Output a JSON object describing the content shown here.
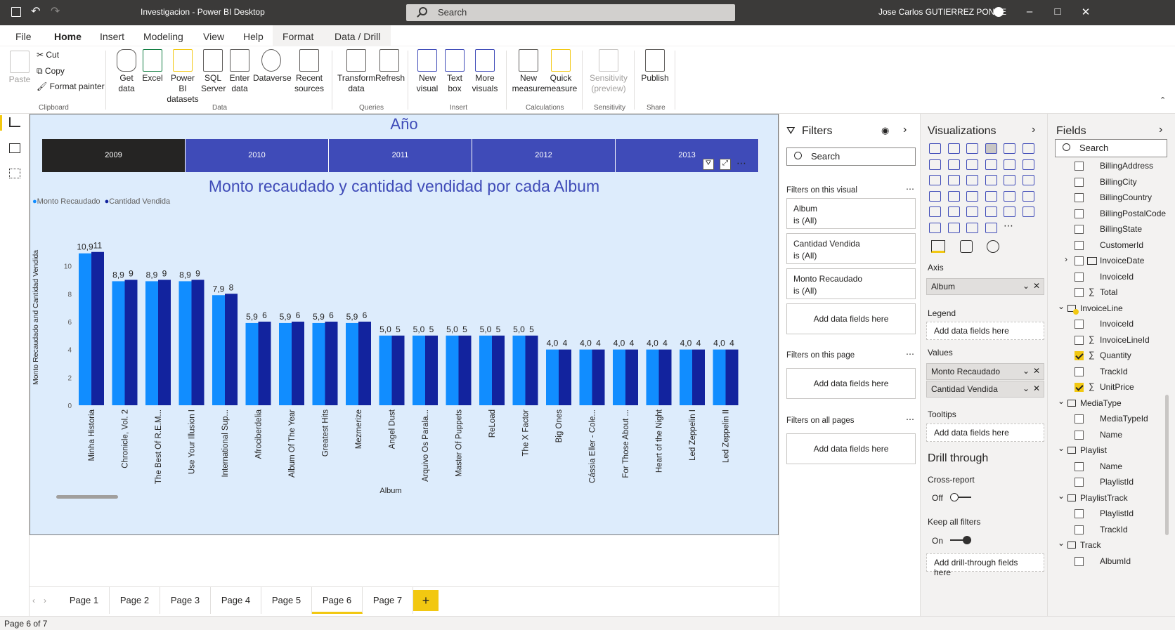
{
  "window": {
    "title": "Investigacion - Power BI Desktop",
    "search": "Search",
    "user": "Jose Carlos GUTIERREZ PONCE"
  },
  "tabs": [
    "File",
    "Home",
    "Insert",
    "Modeling",
    "View",
    "Help",
    "Format",
    "Data / Drill"
  ],
  "ribbon": {
    "paste": "Paste",
    "cut": "Cut",
    "copy": "Copy",
    "format_painter": "Format painter",
    "get_data": "Get data",
    "excel": "Excel",
    "pbi_datasets": "Power BI datasets",
    "sql_server": "SQL Server",
    "enter_data": "Enter data",
    "dataverse": "Dataverse",
    "recent_sources": "Recent sources",
    "transform_data": "Transform data",
    "refresh": "Refresh",
    "new_visual": "New visual",
    "text_box": "Text box",
    "more_visuals": "More visuals",
    "new_measure": "New measure",
    "quick_measure": "Quick measure",
    "sensitivity": "Sensitivity (preview)",
    "publish": "Publish",
    "groups": {
      "clipboard": "Clipboard",
      "data": "Data",
      "queries": "Queries",
      "insert": "Insert",
      "calculations": "Calculations",
      "sensitivity": "Sensitivity",
      "share": "Share"
    }
  },
  "slicer": {
    "title": "Año",
    "years": [
      "2009",
      "2010",
      "2011",
      "2012",
      "2013"
    ],
    "selected": "2009"
  },
  "chart_data": {
    "type": "bar",
    "title": "Monto recaudado y cantidad vendidad por cada Album",
    "xlabel": "Album",
    "ylabel": "Monto Recaudado and Cantidad Vendida",
    "ylim": [
      0,
      12
    ],
    "yticks": [
      0,
      2,
      4,
      6,
      8,
      10
    ],
    "legend_position": "top-left",
    "categories": [
      "Minha Historia",
      "Chronicle, Vol. 2",
      "The Best Of R.E.M...",
      "Use Your Illusion I",
      "International Sup...",
      "Afrociberdelia",
      "Album Of The Year",
      "Greatest Hits",
      "Mezmerize",
      "Angel Dust",
      "Arquivo Os Parala...",
      "Master Of Puppets",
      "ReLoad",
      "The X Factor",
      "Big Ones",
      "Cássia Eller - Cole...",
      "For Those About ...",
      "Heart of the Night",
      "Led Zeppelin I",
      "Led Zeppelin II"
    ],
    "series": [
      {
        "name": "Monto Recaudado",
        "color": "#118dff",
        "values": [
          10.9,
          8.9,
          8.9,
          8.9,
          7.9,
          5.9,
          5.9,
          5.9,
          5.9,
          5.0,
          5.0,
          5.0,
          5.0,
          5.0,
          4.0,
          4.0,
          4.0,
          4.0,
          4.0,
          4.0
        ],
        "labels": [
          "10,9",
          "8,9",
          "8,9",
          "8,9",
          "7,9",
          "5,9",
          "5,9",
          "5,9",
          "5,9",
          "5,0",
          "5,0",
          "5,0",
          "5,0",
          "5,0",
          "4,0",
          "4,0",
          "4,0",
          "4,0",
          "4,0",
          "4,0"
        ]
      },
      {
        "name": "Cantidad Vendida",
        "color": "#12239e",
        "values": [
          11,
          9,
          9,
          9,
          8,
          6,
          6,
          6,
          6,
          5,
          5,
          5,
          5,
          5,
          4,
          4,
          4,
          4,
          4,
          4
        ],
        "labels": [
          "11",
          "9",
          "9",
          "9",
          "8",
          "6",
          "6",
          "6",
          "6",
          "5",
          "5",
          "5",
          "5",
          "5",
          "4",
          "4",
          "4",
          "4",
          "4",
          "4"
        ]
      }
    ]
  },
  "filters": {
    "title": "Filters",
    "search": "Search",
    "on_visual": "Filters on this visual",
    "cards": [
      {
        "name": "Album",
        "state": "is (All)"
      },
      {
        "name": "Cantidad Vendida",
        "state": "is (All)"
      },
      {
        "name": "Monto Recaudado",
        "state": "is (All)"
      }
    ],
    "add_fields": "Add data fields here",
    "on_page": "Filters on this page",
    "on_all": "Filters on all pages"
  },
  "visualizations": {
    "title": "Visualizations",
    "axis": "Axis",
    "axis_field": "Album",
    "legend": "Legend",
    "add_fields": "Add data fields here",
    "values": "Values",
    "value_fields": [
      "Monto Recaudado",
      "Cantidad Vendida"
    ],
    "tooltips": "Tooltips",
    "drill_through": "Drill through",
    "cross_report": "Cross-report",
    "cross_report_state": "Off",
    "keep_filters": "Keep all filters",
    "keep_filters_state": "On",
    "add_drill": "Add drill-through fields here"
  },
  "fields": {
    "title": "Fields",
    "search": "Search",
    "items": [
      {
        "label": "BillingAddress",
        "type": "field",
        "checked": false
      },
      {
        "label": "BillingCity",
        "type": "field",
        "checked": false
      },
      {
        "label": "BillingCountry",
        "type": "field",
        "checked": false
      },
      {
        "label": "BillingPostalCode",
        "type": "field",
        "checked": false
      },
      {
        "label": "BillingState",
        "type": "field",
        "checked": false
      },
      {
        "label": "CustomerId",
        "type": "field",
        "checked": false
      },
      {
        "label": "InvoiceDate",
        "type": "date",
        "checked": false
      },
      {
        "label": "InvoiceId",
        "type": "field",
        "checked": false
      },
      {
        "label": "Total",
        "type": "sum",
        "checked": false
      },
      {
        "label": "InvoiceLine",
        "type": "table",
        "checked": true
      },
      {
        "label": "InvoiceId",
        "type": "field",
        "checked": false
      },
      {
        "label": "InvoiceLineId",
        "type": "sum",
        "checked": false
      },
      {
        "label": "Quantity",
        "type": "sum",
        "checked": true
      },
      {
        "label": "TrackId",
        "type": "field",
        "checked": false
      },
      {
        "label": "UnitPrice",
        "type": "sum",
        "checked": true
      },
      {
        "label": "MediaType",
        "type": "table",
        "checked": false
      },
      {
        "label": "MediaTypeId",
        "type": "field",
        "checked": false
      },
      {
        "label": "Name",
        "type": "field",
        "checked": false
      },
      {
        "label": "Playlist",
        "type": "table",
        "checked": false
      },
      {
        "label": "Name",
        "type": "field",
        "checked": false
      },
      {
        "label": "PlaylistId",
        "type": "field",
        "checked": false
      },
      {
        "label": "PlaylistTrack",
        "type": "table",
        "checked": false
      },
      {
        "label": "PlaylistId",
        "type": "field",
        "checked": false
      },
      {
        "label": "TrackId",
        "type": "field",
        "checked": false
      },
      {
        "label": "Track",
        "type": "table",
        "checked": false
      },
      {
        "label": "AlbumId",
        "type": "field",
        "checked": false
      }
    ]
  },
  "pages": [
    "Page 1",
    "Page 2",
    "Page 3",
    "Page 4",
    "Page 5",
    "Page 6",
    "Page 7"
  ],
  "active_page": "Page 6",
  "status": "Page 6 of 7",
  "colors": {
    "accent": "#f2c811",
    "slicer_selected": "#252423",
    "slicer_tile": "#3f4bb8"
  }
}
